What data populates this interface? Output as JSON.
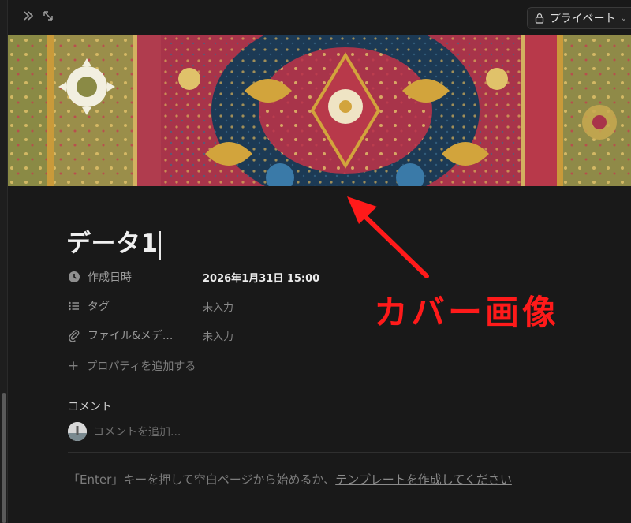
{
  "topbar": {
    "privacy_label": "プライベート"
  },
  "page": {
    "title": "データ1"
  },
  "properties": [
    {
      "icon": "clock-icon",
      "label": "作成日時",
      "value": "2026年1月31日 15:00"
    },
    {
      "icon": "list-icon",
      "label": "タグ",
      "value": "未入力"
    },
    {
      "icon": "paperclip-icon",
      "label": "ファイル&メデ...",
      "value": "未入力"
    }
  ],
  "add_property_label": "プロパティを追加する",
  "comments": {
    "heading": "コメント",
    "placeholder": "コメントを追加..."
  },
  "hint": {
    "prefix": "「Enter」キーを押して空白ページから始めるか、",
    "link": "テンプレートを作成してください"
  },
  "annotation": {
    "text": "カバー画像",
    "color": "#ff1a1a"
  },
  "colors": {
    "background": "#191919",
    "cover_red": "#a8344a",
    "cover_navy": "#1c3a55",
    "cover_gold": "#d2a43c",
    "cover_olive": "#8a8a45"
  }
}
